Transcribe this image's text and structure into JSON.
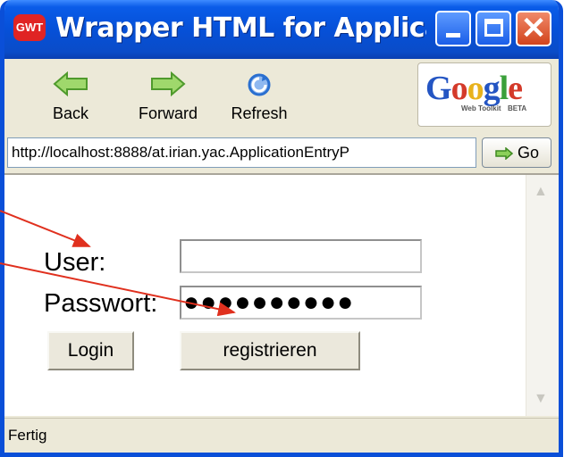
{
  "window": {
    "title": "Wrapper HTML for ApplicationE...",
    "app_icon": "GWT"
  },
  "toolbar": {
    "back_label": "Back",
    "forward_label": "Forward",
    "refresh_label": "Refresh",
    "logo_text": "Google",
    "logo_sub": "Web Toolkit",
    "logo_beta": "BETA"
  },
  "address": {
    "url": "http://localhost:8888/at.irian.yac.ApplicationEntryP",
    "go_label": "Go"
  },
  "form": {
    "user_label": "User:",
    "user_value": "",
    "password_label": "Passwort:",
    "password_value": "●●●●●●●●●●",
    "login_label": "Login",
    "register_label": "registrieren"
  },
  "status": {
    "text": "Fertig"
  },
  "colors": {
    "titlebar": "#0650d8",
    "close_button": "#d2431c",
    "annotation_arrow": "#e0301e"
  }
}
